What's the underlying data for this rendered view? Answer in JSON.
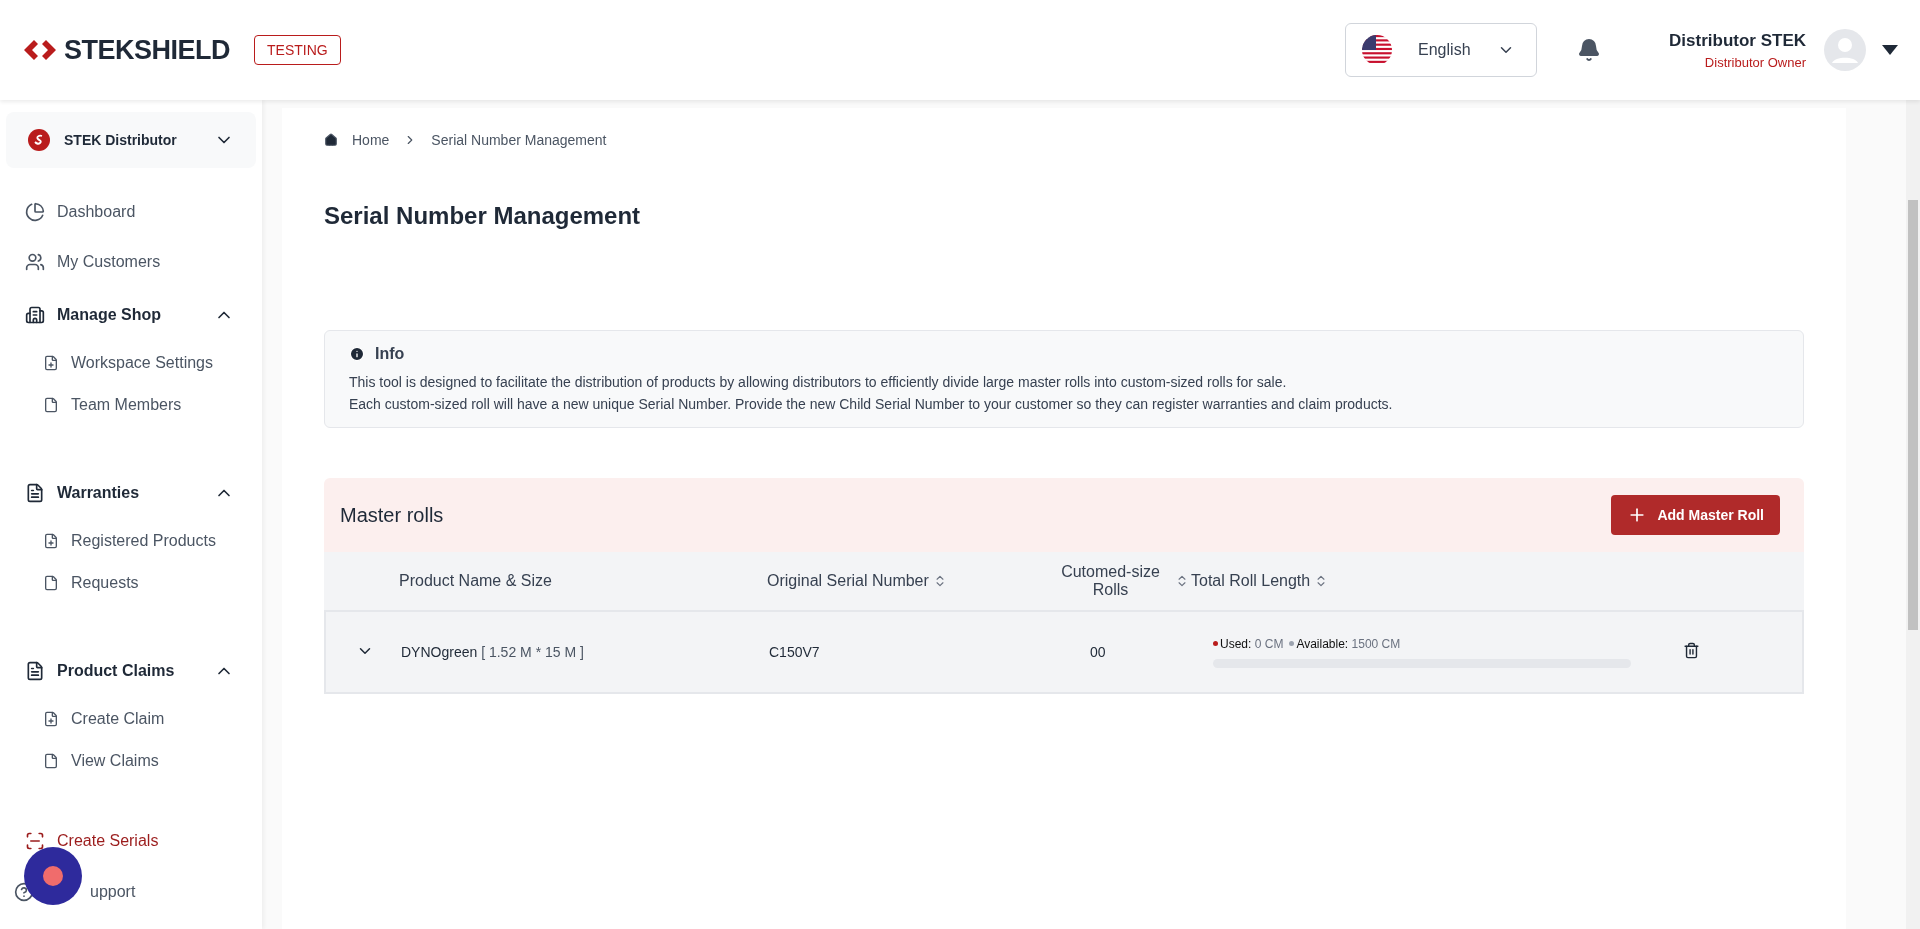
{
  "header": {
    "logo": "STEKSHIELD",
    "env_badge": "TESTING",
    "language": "English",
    "user": {
      "name": "Distributor STEK",
      "role": "Distributor Owner"
    }
  },
  "sidebar": {
    "workspace": "STEK Distributor",
    "items": [
      {
        "kind": "link",
        "label": "Dashboard",
        "selected": false
      },
      {
        "kind": "link",
        "label": "My Customers",
        "selected": false
      },
      {
        "kind": "section",
        "label": "Manage Shop",
        "expanded": true,
        "children": [
          {
            "label": "Workspace Settings",
            "selected": false
          },
          {
            "label": "Team Members",
            "selected": false
          }
        ]
      },
      {
        "kind": "section",
        "label": "Warranties",
        "expanded": true,
        "children": [
          {
            "label": "Registered Products",
            "selected": false
          },
          {
            "label": "Requests",
            "selected": false
          }
        ]
      },
      {
        "kind": "section",
        "label": "Product Claims",
        "expanded": true,
        "children": [
          {
            "label": "Create Claim",
            "selected": false
          },
          {
            "label": "View Claims",
            "selected": false
          }
        ]
      },
      {
        "kind": "link",
        "label": "Create Serials",
        "selected": true
      },
      {
        "kind": "link",
        "label": "upport",
        "selected": false
      }
    ]
  },
  "breadcrumb": [
    "Home",
    "Serial Number Management"
  ],
  "title": "Serial Number Management",
  "info": {
    "heading": "Info",
    "lines": [
      "This tool is designed to facilitate the distribution of products by allowing distributors to efficiently divide large master rolls into custom-sized rolls for sale.",
      "Each custom-sized roll will have a new unique Serial Number. Provide the new Child Serial Number to your customer so they can register warranties and claim products."
    ]
  },
  "master_rolls": {
    "title": "Master rolls",
    "add_button": "Add Master Roll",
    "columns": [
      {
        "label": "Product Name & Size",
        "sortable": false
      },
      {
        "label": "Original Serial Number",
        "sortable": true
      },
      {
        "label": "Cutomed-size Rolls",
        "sortable": true
      },
      {
        "label": "Total Roll Length",
        "sortable": true
      }
    ],
    "rows": [
      {
        "expanded": false,
        "product": "DYNOgreen",
        "size": "[ 1.52 M * 15 M ]",
        "serial": "C150V7",
        "rolls": "00",
        "legend": [
          {
            "label": "Used:",
            "value": "0 CM",
            "color": "#b91c1c"
          },
          {
            "label": "Available:",
            "value": "1500 CM",
            "color": "#9ca3af"
          }
        ],
        "level": 0
      }
    ]
  }
}
